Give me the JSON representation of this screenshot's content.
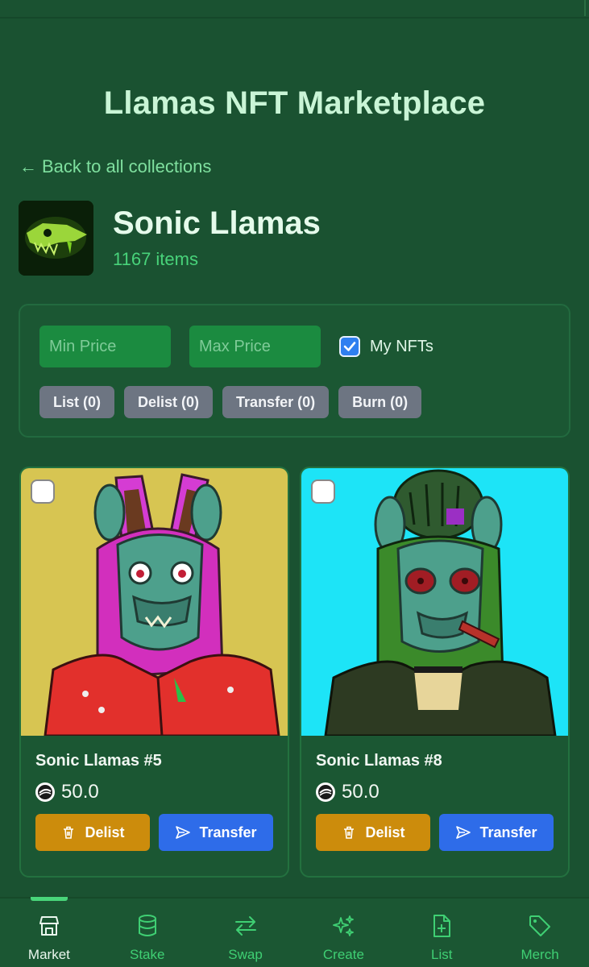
{
  "page": {
    "title": "Llamas NFT Marketplace",
    "back_link": "Back to all collections"
  },
  "collection": {
    "name": "Sonic Llamas",
    "count": "1167 items"
  },
  "filters": {
    "min_price_placeholder": "Min Price",
    "max_price_placeholder": "Max Price",
    "my_nfts_label": "My NFTs",
    "my_nfts_checked": true,
    "actions": [
      "List (0)",
      "Delist (0)",
      "Transfer (0)",
      "Burn (0)"
    ]
  },
  "cards": [
    {
      "title": "Sonic Llamas #5",
      "price": "50.0",
      "delist_label": "Delist",
      "transfer_label": "Transfer",
      "background": "#d7c552"
    },
    {
      "title": "Sonic Llamas #8",
      "price": "50.0",
      "delist_label": "Delist",
      "transfer_label": "Transfer",
      "background": "#1de4f7"
    }
  ],
  "nav": {
    "items": [
      {
        "label": "Market",
        "icon": "store-icon",
        "active": true
      },
      {
        "label": "Stake",
        "icon": "database-icon",
        "active": false
      },
      {
        "label": "Swap",
        "icon": "swap-arrows-icon",
        "active": false
      },
      {
        "label": "Create",
        "icon": "sparkles-icon",
        "active": false
      },
      {
        "label": "List",
        "icon": "file-plus-icon",
        "active": false
      },
      {
        "label": "Merch",
        "icon": "tag-icon",
        "active": false
      }
    ]
  },
  "colors": {
    "background": "#1a5231",
    "accent": "#48d37a",
    "delist": "#cc8c0c",
    "transfer": "#2e6ce9"
  }
}
